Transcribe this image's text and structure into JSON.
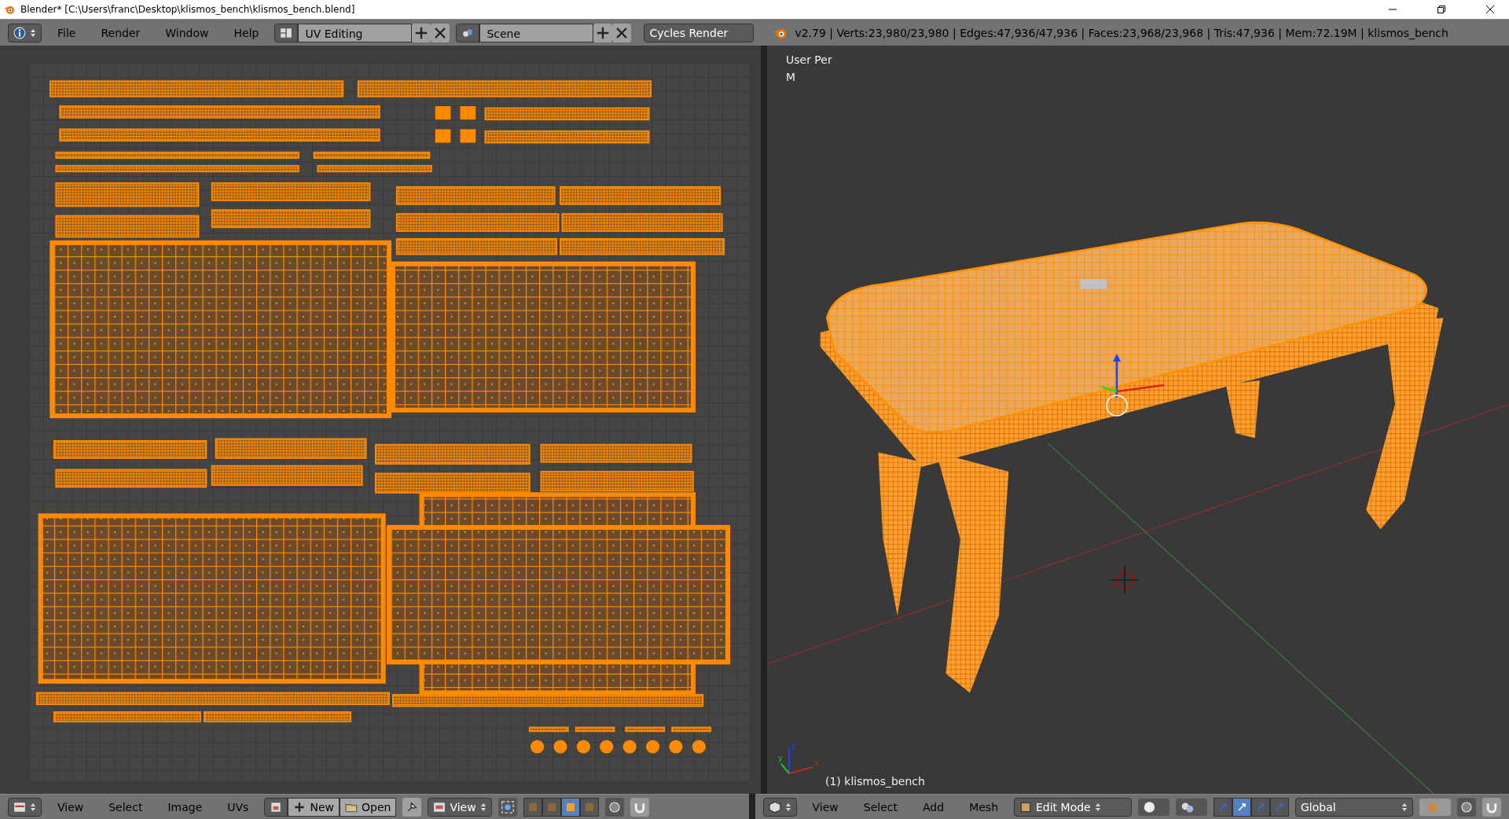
{
  "window": {
    "title": "Blender* [C:\\Users\\franc\\Desktop\\klismos_bench\\klismos_bench.blend]"
  },
  "info_header": {
    "menus": [
      "File",
      "Render",
      "Window",
      "Help"
    ],
    "screen_layout": "UV Editing",
    "scene": "Scene",
    "render_engine": "Cycles Render",
    "stats": "v2.79 | Verts:23,980/23,980 | Edges:47,936/47,936 | Faces:23,968/23,968 | Tris:47,936 | Mem:72.19M | klismos_bench"
  },
  "uv_editor_header": {
    "menus": [
      "View",
      "Select",
      "Image",
      "UVs"
    ],
    "new_button": "New",
    "open_button": "Open",
    "view_menu": "View",
    "select_modes": [
      {
        "selected": false
      },
      {
        "selected": false
      },
      {
        "selected": true
      },
      {
        "selected": false
      }
    ]
  },
  "viewport": {
    "view_label": "User Per",
    "units_label": "M",
    "object_label": "(1) klismos_bench",
    "axes": [
      "z",
      "y",
      "x"
    ]
  },
  "viewport_header": {
    "menus": [
      "View",
      "Select",
      "Add",
      "Mesh"
    ],
    "mode": "Edit Mode",
    "manipulators": [
      {
        "selected": false
      },
      {
        "selected": true
      },
      {
        "selected": false
      },
      {
        "selected": false
      }
    ],
    "orientation": "Global"
  }
}
